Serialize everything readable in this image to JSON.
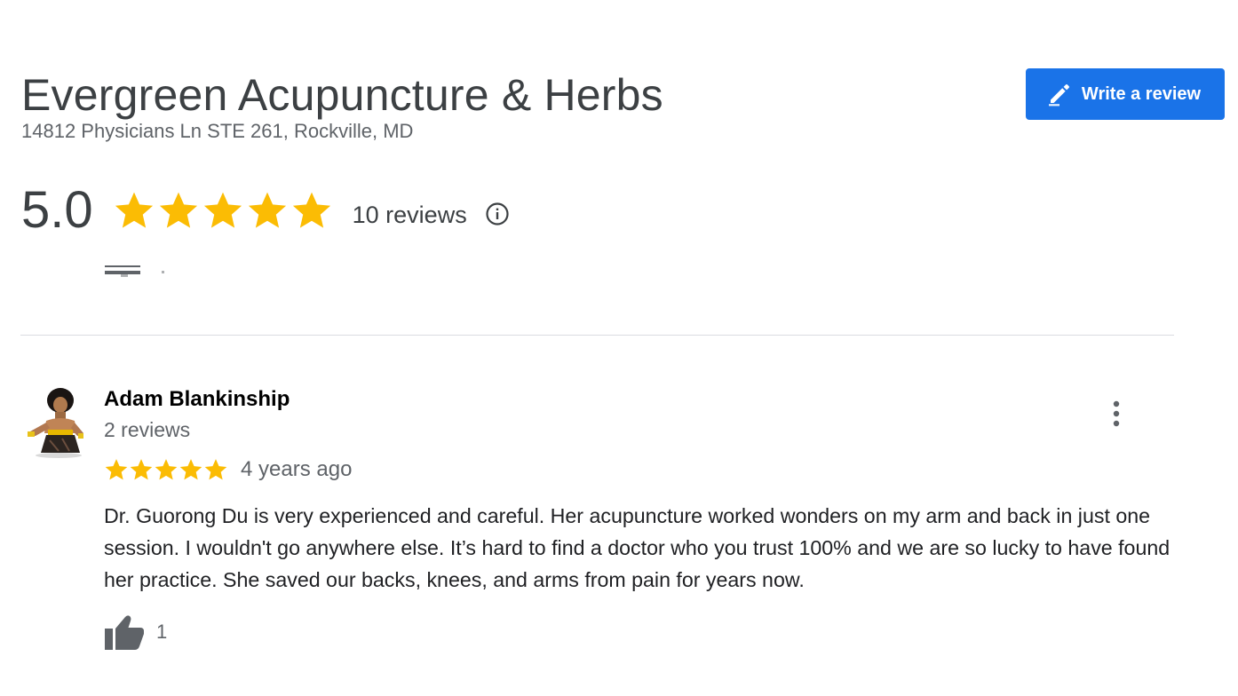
{
  "business": {
    "name": "Evergreen Acupuncture & Herbs",
    "address": "14812 Physicians Ln STE 261, Rockville, MD"
  },
  "actions": {
    "write_review_label": "Write a review"
  },
  "rating": {
    "value": "5.0",
    "stars": 5,
    "reviews_count": "10 reviews",
    "info_icon": "info-icon"
  },
  "review": {
    "reviewer_name": "Adam Blankinship",
    "reviewer_reviews": "2 reviews",
    "stars": 5,
    "date": "4 years ago",
    "text": "Dr. Guorong Du is very experienced and careful. Her acupuncture worked wonders on my arm and back in just one session. I wouldn't go anywhere else. It’s hard to find a doctor who you trust 100% and we are so lucky to have found her practice. She saved our backs, knees, and arms from pain for years now.",
    "likes": "1",
    "icons": {
      "more": "more-vert-icon",
      "like": "thumb-up-icon",
      "avatar": "avatar"
    }
  },
  "colors": {
    "accent": "#1a73e8",
    "star": "#fbbc04",
    "divider": "#dadce0",
    "muted_text": "#5f6368"
  }
}
